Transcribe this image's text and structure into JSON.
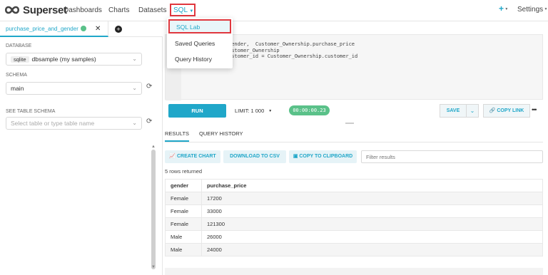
{
  "app": {
    "brand": "Superset",
    "accent_color": "#20a7c9",
    "highlight_color": "#e0373e"
  },
  "nav": {
    "dashboards": "Dashboards",
    "charts": "Charts",
    "datasets": "Datasets",
    "sql": "SQL",
    "plus": "+",
    "settings": "Settings"
  },
  "sql_menu": {
    "items": [
      "SQL Lab",
      "Saved Queries",
      "Query History"
    ],
    "active_index": 0
  },
  "query_tab": {
    "name": "purchase_price_and_gender",
    "status": "success",
    "close": "✕",
    "add": "+"
  },
  "left": {
    "database_label": "DATABASE",
    "database_badge": "sqlite",
    "database_value": "dbsample (my samples)",
    "schema_label": "SCHEMA",
    "schema_value": "main",
    "table_label": "SEE TABLE SCHEMA",
    "table_placeholder": "Select table or type table name"
  },
  "editor": {
    "lines": [
      "gender,  Customer_Ownership.purchase_price",
      "ustomer_Ownership",
      "ustomer_id = Customer_Ownership.customer_id"
    ]
  },
  "toolbar": {
    "run": "RUN",
    "limit": "LIMIT: 1 000",
    "timer": "00:00:00.23",
    "save": "SAVE",
    "copy_link": "COPY LINK",
    "more": "•••"
  },
  "results": {
    "tabs": [
      "RESULTS",
      "QUERY HISTORY"
    ],
    "create_chart": "CREATE CHART",
    "download_csv": "DOWNLOAD TO CSV",
    "copy_clipboard": "COPY TO CLIPBOARD",
    "filter_placeholder": "Filter results",
    "rows_returned": "5 rows returned",
    "columns": [
      "gender",
      "purchase_price"
    ],
    "rows": [
      [
        "Female",
        "17200"
      ],
      [
        "Female",
        "33000"
      ],
      [
        "Female",
        "121300"
      ],
      [
        "Male",
        "26000"
      ],
      [
        "Male",
        "24000"
      ]
    ]
  }
}
